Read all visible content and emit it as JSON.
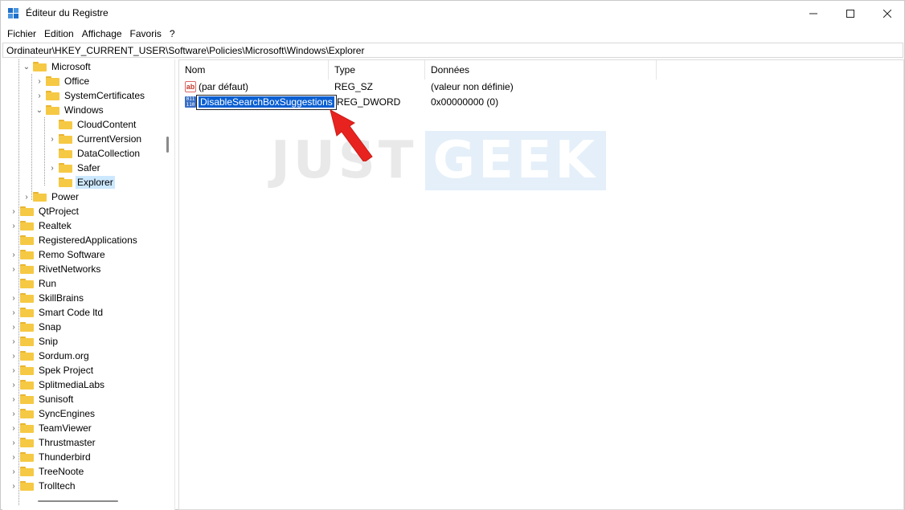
{
  "window": {
    "title": "Éditeur du Registre"
  },
  "menu": [
    "Fichier",
    "Edition",
    "Affichage",
    "Favoris",
    "?"
  ],
  "address": "Ordinateur\\HKEY_CURRENT_USER\\Software\\Policies\\Microsoft\\Windows\\Explorer",
  "tree": [
    {
      "label": "Microsoft",
      "expanded": true
    },
    {
      "label": "Office"
    },
    {
      "label": "SystemCertificates"
    },
    {
      "label": "Windows",
      "expanded": true
    },
    {
      "label": "CloudContent"
    },
    {
      "label": "CurrentVersion"
    },
    {
      "label": "DataCollection"
    },
    {
      "label": "Safer"
    },
    {
      "label": "Explorer",
      "selected": true
    },
    {
      "label": "Power"
    },
    {
      "label": "QtProject"
    },
    {
      "label": "Realtek"
    },
    {
      "label": "RegisteredApplications"
    },
    {
      "label": "Remo Software"
    },
    {
      "label": "RivetNetworks"
    },
    {
      "label": "Run"
    },
    {
      "label": "SkillBrains"
    },
    {
      "label": "Smart Code ltd"
    },
    {
      "label": "Snap"
    },
    {
      "label": "Snip"
    },
    {
      "label": "Sordum.org"
    },
    {
      "label": "Spek Project"
    },
    {
      "label": "SplitmediaLabs"
    },
    {
      "label": "Sunisoft"
    },
    {
      "label": "SyncEngines"
    },
    {
      "label": "TeamViewer"
    },
    {
      "label": "Thrustmaster"
    },
    {
      "label": "Thunderbird"
    },
    {
      "label": "TreeNoote"
    },
    {
      "label": "Trolltech"
    }
  ],
  "list": {
    "columns": [
      "Nom",
      "Type",
      "Données"
    ],
    "rows": [
      {
        "name": "(par défaut)",
        "type": "REG_SZ",
        "data": "(valeur non définie)",
        "icon": "string-value-icon"
      },
      {
        "name": "DisableSearchBoxSuggestions",
        "type": "REG_DWORD",
        "data": "0x00000000 (0)",
        "icon": "dword-value-icon",
        "editing": true
      }
    ]
  },
  "watermark": {
    "part1": "JUST",
    "part2": "GEEK"
  },
  "colors": {
    "selection": "#0a5fd1",
    "tree_selected": "#cce8ff",
    "arrow": "#e8231f",
    "folder": "#f6c944"
  }
}
